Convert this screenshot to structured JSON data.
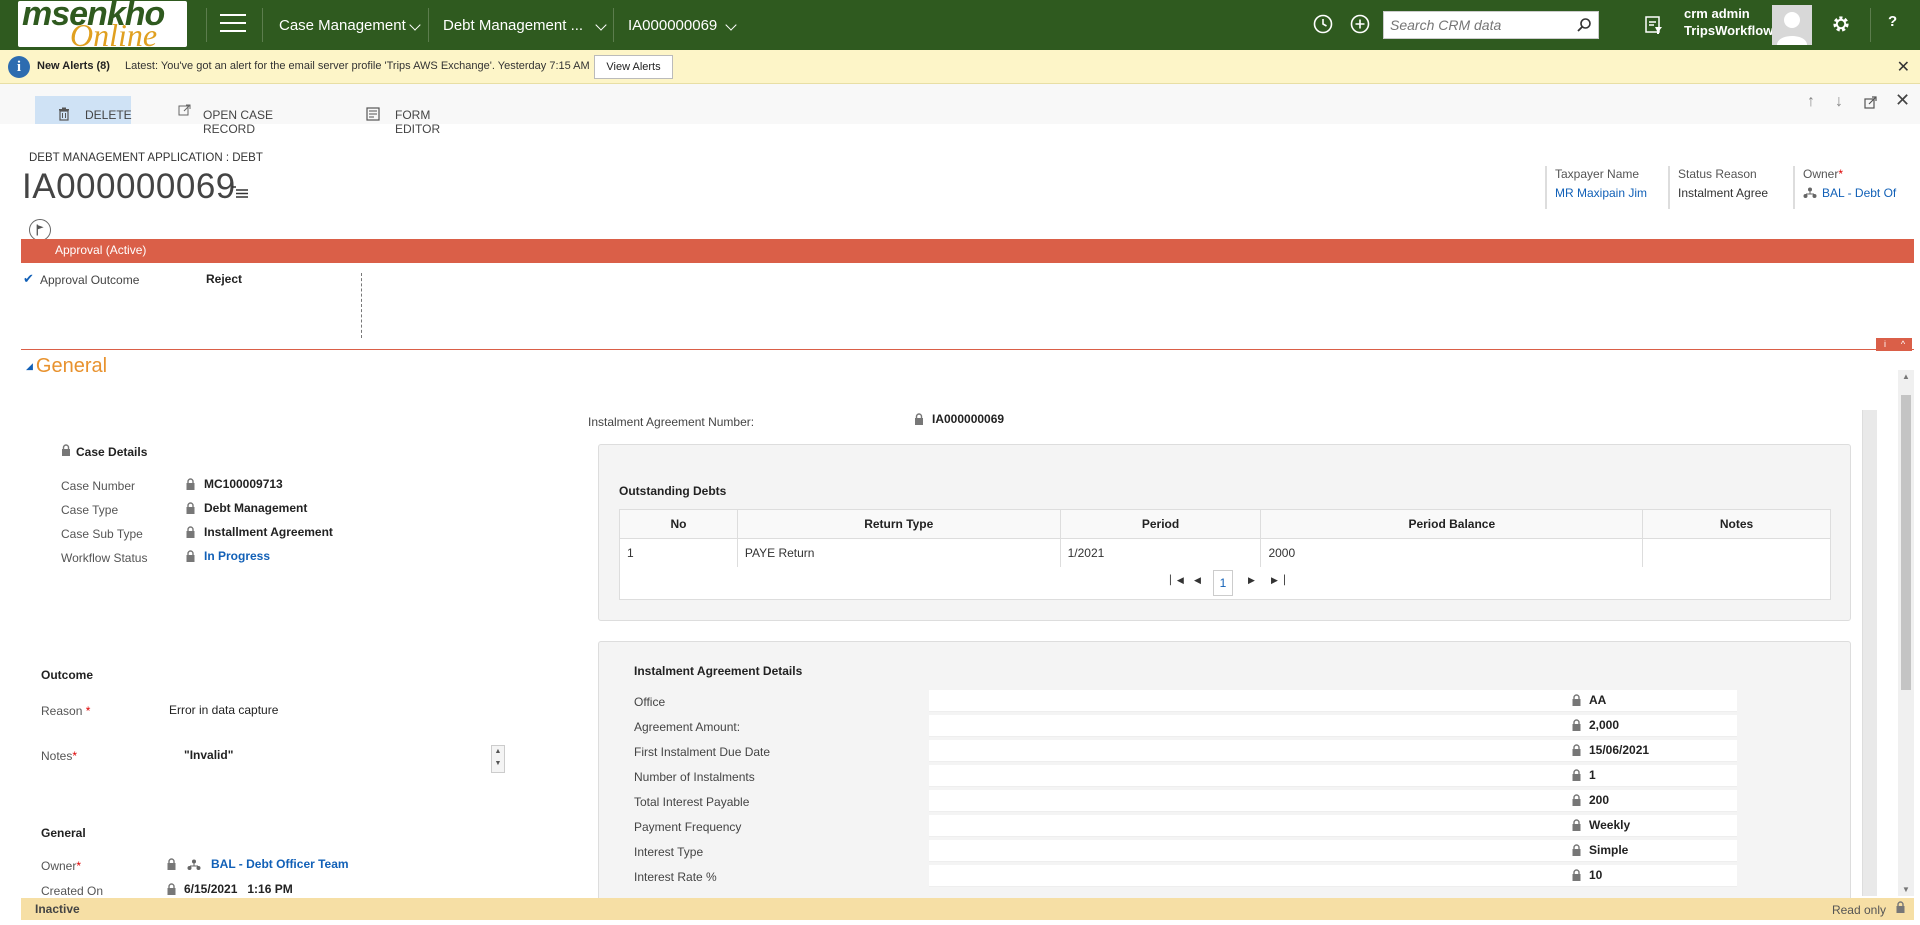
{
  "topnav": {
    "logo_text_1": "msenkho",
    "logo_text_2": "Online",
    "nav_items": [
      "Case Management",
      "Debt Management ...",
      "IA000000069"
    ],
    "search_placeholder": "Search CRM data",
    "user_name": "crm admin",
    "user_org": "TripsWorkflow",
    "help_label": "?"
  },
  "alerts": {
    "title": "New Alerts (8)",
    "message": "Latest: You've got an alert for the email server profile 'Trips AWS Exchange'. Yesterday 7:15 AM",
    "button": "View Alerts"
  },
  "commands": {
    "delete": "DELETE",
    "open_case": "OPEN CASE RECORD",
    "form_editor": "FORM EDITOR"
  },
  "header": {
    "entity": "DEBT MANAGEMENT APPLICATION : DEBT",
    "record_id": "IA000000069",
    "fields": [
      {
        "label": "Taxpayer Name",
        "value": "MR Maxipain Jim",
        "required": ""
      },
      {
        "label": "Status Reason",
        "value": "Instalment Agree",
        "required": ""
      },
      {
        "label": "Owner",
        "value": "BAL - Debt Of",
        "required": "*"
      }
    ]
  },
  "process": {
    "stage": "Approval (Active)",
    "field_label": "Approval Outcome",
    "field_value": "Reject"
  },
  "section": {
    "title": "General"
  },
  "case_details": {
    "title": "Case Details",
    "rows": [
      {
        "label": "Case Number",
        "value": "MC100009713"
      },
      {
        "label": "Case Type",
        "value": "Debt Management"
      },
      {
        "label": "Case Sub Type",
        "value": "Installment Agreement"
      },
      {
        "label": "Workflow Status",
        "value": "In Progress"
      }
    ]
  },
  "outcome": {
    "title": "Outcome",
    "reason_label": "Reason",
    "reason_value": "Error in data capture",
    "notes_label": "Notes",
    "notes_value": "\"Invalid\"",
    "required": "*"
  },
  "general_group": {
    "title": "General",
    "owner_label": "Owner",
    "owner_value": "BAL - Debt Officer Team",
    "created_label": "Created On",
    "created_value": "6/15/2021   1:16 PM"
  },
  "ia_number": {
    "label": "Instalment Agreement Number:",
    "value": "IA000000069"
  },
  "outstanding": {
    "title": "Outstanding Debts",
    "columns": [
      "No",
      "Return Type",
      "Period",
      "Period Balance",
      "Notes"
    ],
    "rows": [
      [
        "1",
        "PAYE Return",
        "1/2021",
        "2000",
        ""
      ]
    ],
    "page": "1"
  },
  "ia_details": {
    "title": "Instalment Agreement Details",
    "rows": [
      {
        "label": "Office",
        "value": "AA"
      },
      {
        "label": "Agreement Amount:",
        "value": "2,000"
      },
      {
        "label": "First Instalment Due Date",
        "value": "15/06/2021"
      },
      {
        "label": "Number of Instalments",
        "value": "1"
      },
      {
        "label": "Total Interest Payable",
        "value": "200"
      },
      {
        "label": "Payment Frequency",
        "value": "Weekly"
      },
      {
        "label": "Interest Type",
        "value": "Simple"
      },
      {
        "label": "Interest Rate %",
        "value": "10"
      }
    ]
  },
  "footer": {
    "status": "Inactive",
    "mode": "Read only"
  },
  "colors": {
    "nav_bg": "#2f5a1f",
    "stage_bar": "#da5f48",
    "section_title": "#e8922e",
    "link": "#1160b7",
    "alert_bg": "#fdf5c8",
    "footer_bg": "#f6dfa5"
  }
}
